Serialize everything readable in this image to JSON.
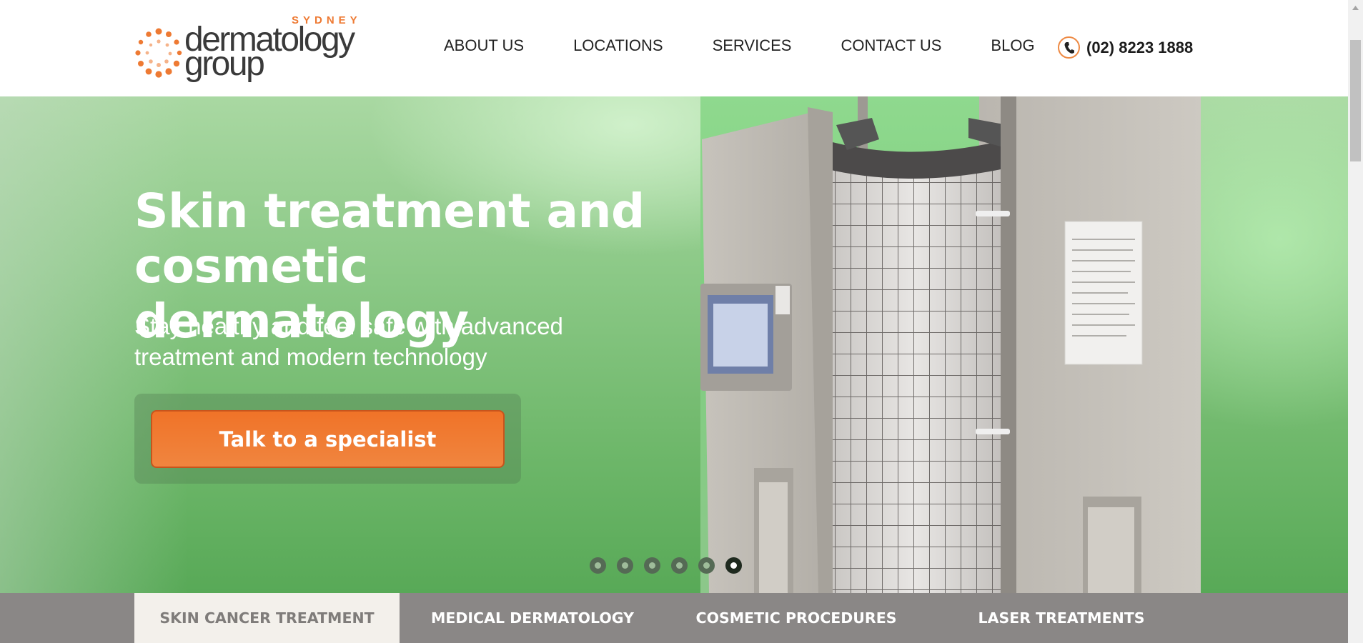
{
  "header": {
    "logo": {
      "city": "SYDNEY",
      "line1": "dermatology",
      "line2": "group"
    },
    "nav": [
      {
        "label": "ABOUT US"
      },
      {
        "label": "LOCATIONS"
      },
      {
        "label": "SERVICES"
      },
      {
        "label": "CONTACT US"
      },
      {
        "label": "BLOG"
      }
    ],
    "phone": {
      "icon": "phone-icon",
      "number": "(02) 8223 1888"
    }
  },
  "hero": {
    "title_line1": "Skin treatment and",
    "title_line2": "cosmetic dermatology",
    "subtitle_line1": "Stay healthy and feel safe with advanced",
    "subtitle_line2": "treatment and modern technology",
    "cta_label": "Talk to a specialist",
    "slider": {
      "count": 6,
      "active_index": 6
    }
  },
  "tabs": [
    {
      "label": "SKIN CANCER TREATMENT",
      "active": true
    },
    {
      "label": "MEDICAL DERMATOLOGY",
      "active": false
    },
    {
      "label": "COSMETIC PROCEDURES",
      "active": false
    },
    {
      "label": "LASER TREATMENTS",
      "active": false
    }
  ],
  "colors": {
    "brand_orange": "#ee7a33",
    "cta_orange": "#f07328",
    "tab_bar": "#8a8786",
    "tab_active_bg": "#f3f0eb"
  }
}
